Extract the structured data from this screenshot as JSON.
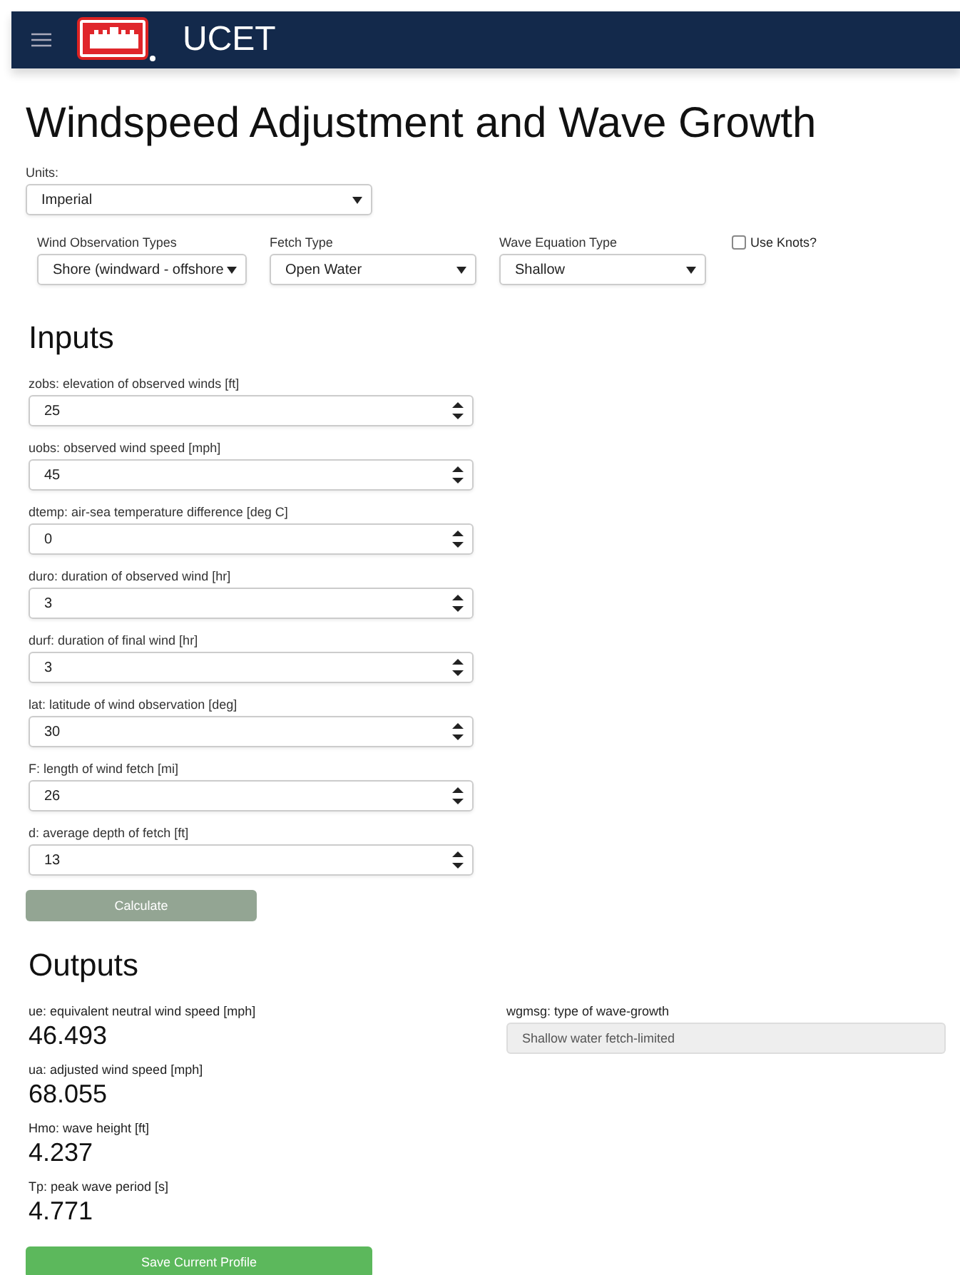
{
  "header": {
    "app_name": "UCET"
  },
  "title": "Windspeed Adjustment and Wave Growth",
  "units": {
    "label": "Units:",
    "value": "Imperial"
  },
  "options": [
    {
      "kind": "select",
      "label": "Wind Observation Types",
      "value": "Shore (windward - offshore"
    },
    {
      "kind": "select",
      "label": "Fetch Type",
      "value": "Open Water"
    },
    {
      "kind": "select",
      "label": "Wave Equation Type",
      "value": "Shallow"
    },
    {
      "kind": "checkbox",
      "label": "Use Knots?",
      "checked": false
    }
  ],
  "inputs_heading": "Inputs",
  "inputs": [
    {
      "label": "zobs: elevation of observed winds [ft]",
      "value": "25"
    },
    {
      "label": "uobs: observed wind speed [mph]",
      "value": "45"
    },
    {
      "label": "dtemp: air-sea temperature difference [deg C]",
      "value": "0"
    },
    {
      "label": "duro: duration of observed wind [hr]",
      "value": "3"
    },
    {
      "label": "durf: duration of final wind [hr]",
      "value": "3"
    },
    {
      "label": "lat: latitude of wind observation [deg]",
      "value": "30"
    },
    {
      "label": "F: length of wind fetch [mi]",
      "value": "26"
    },
    {
      "label": "d: average depth of fetch [ft]",
      "value": "13"
    }
  ],
  "calculate_button": {
    "label": "Calculate",
    "disabled": true
  },
  "outputs_heading": "Outputs",
  "outputs": [
    {
      "label": "ue: equivalent neutral wind speed [mph]",
      "value": "46.493"
    },
    {
      "label": "ua: adjusted wind speed [mph]",
      "value": "68.055"
    },
    {
      "label": "Hmo: wave height [ft]",
      "value": "4.237"
    },
    {
      "label": "Tp: peak wave period [s]",
      "value": "4.771"
    }
  ],
  "wave_growth": {
    "label": "wgmsg: type of wave-growth",
    "value": "Shallow water fetch-limited"
  },
  "save_button": {
    "label": "Save Current Profile"
  }
}
